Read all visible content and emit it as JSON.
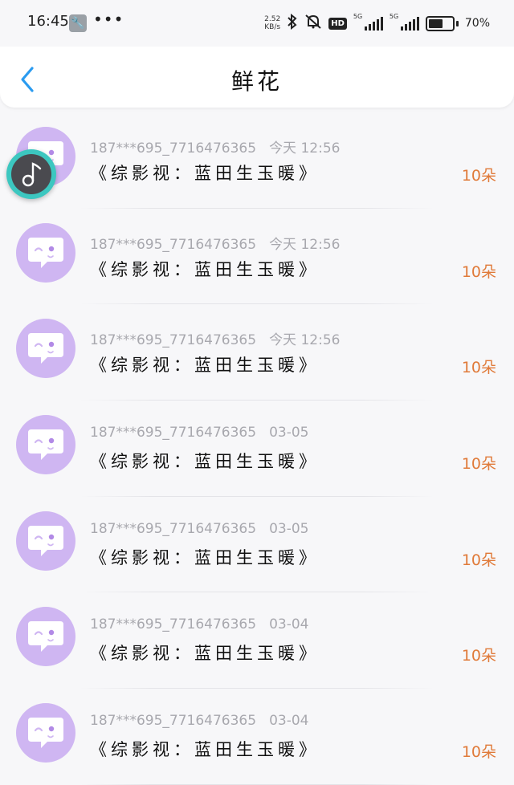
{
  "status_bar": {
    "time": "16:45",
    "more": "•••",
    "net_speed_value": "2.52",
    "net_speed_unit": "KB/s",
    "hd_label": "HD",
    "signal_label_1": "5G",
    "signal_label_2": "5G",
    "battery_percent": 70,
    "battery_text": "70%"
  },
  "header": {
    "back_icon": "chevron-left-icon",
    "title": "鲜花"
  },
  "colors": {
    "accent_blue": "#2a9bf0",
    "avatar_purple": "#cfb6f2",
    "count_orange": "#e07a39",
    "meta_gray": "#a8a8ae",
    "floater_teal": "#3cc7c0"
  },
  "floating_player": {
    "icon": "music-note-icon"
  },
  "items": [
    {
      "user": "187***695_7716476365",
      "time": "今天 12:56",
      "book": "《综影视：蓝田生玉暖》",
      "count": "10朵"
    },
    {
      "user": "187***695_7716476365",
      "time": "今天 12:56",
      "book": "《综影视：蓝田生玉暖》",
      "count": "10朵"
    },
    {
      "user": "187***695_7716476365",
      "time": "今天 12:56",
      "book": "《综影视：蓝田生玉暖》",
      "count": "10朵"
    },
    {
      "user": "187***695_7716476365",
      "time": "03-05",
      "book": "《综影视：蓝田生玉暖》",
      "count": "10朵"
    },
    {
      "user": "187***695_7716476365",
      "time": "03-05",
      "book": "《综影视：蓝田生玉暖》",
      "count": "10朵"
    },
    {
      "user": "187***695_7716476365",
      "time": "03-04",
      "book": "《综影视：蓝田生玉暖》",
      "count": "10朵"
    },
    {
      "user": "187***695_7716476365",
      "time": "03-04",
      "book": "《综影视：蓝田生玉暖》",
      "count": "10朵"
    }
  ]
}
